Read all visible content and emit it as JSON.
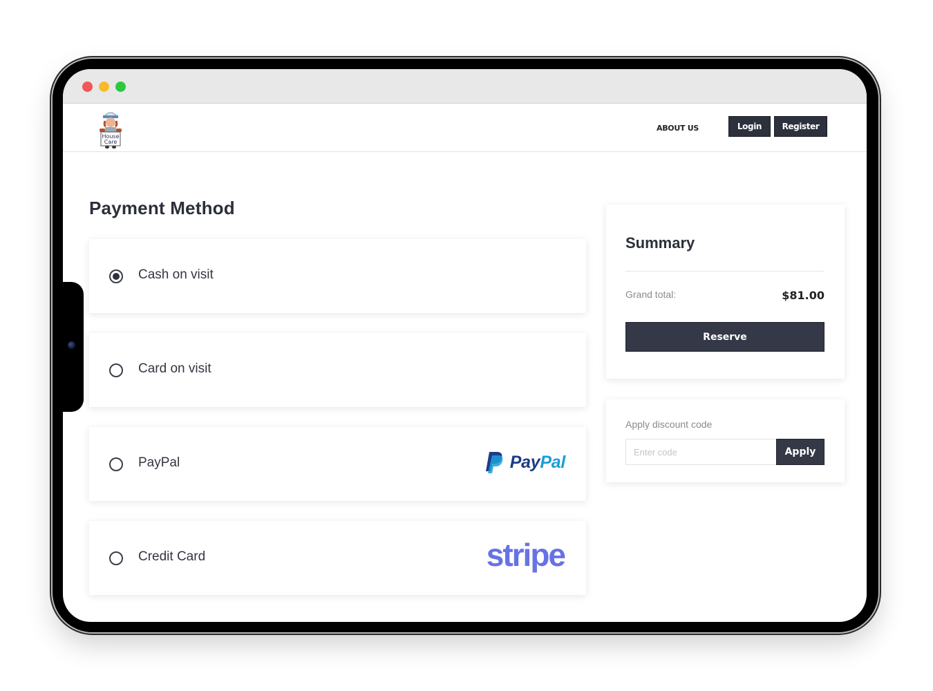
{
  "window": {
    "controls": [
      "close",
      "minimize",
      "maximize"
    ]
  },
  "navbar": {
    "logo_alt": "House Care",
    "about_label": "ABOUT US",
    "login_label": "Login",
    "register_label": "Register"
  },
  "payment": {
    "title": "Payment Method",
    "selected": "cash",
    "options": [
      {
        "id": "cash",
        "label": "Cash on visit",
        "checked": true,
        "logo": null
      },
      {
        "id": "card",
        "label": "Card on visit",
        "checked": false,
        "logo": null
      },
      {
        "id": "paypal",
        "label": "PayPal",
        "checked": false,
        "logo": "paypal-logo"
      },
      {
        "id": "credit",
        "label": "Credit Card",
        "checked": false,
        "logo": "stripe-logo"
      }
    ],
    "paypal_logo": {
      "pay": "Pay",
      "pal": "Pal"
    },
    "stripe_logo": "stripe"
  },
  "summary": {
    "title": "Summary",
    "grand_total_label": "Grand total:",
    "grand_total_value": "$81.00",
    "reserve_label": "Reserve"
  },
  "discount": {
    "label": "Apply discount code",
    "input_value": "",
    "placeholder": "Enter code",
    "apply_label": "Apply"
  },
  "colors": {
    "primary_dark": "#353846",
    "paypal_dark": "#1d3c88",
    "paypal_light": "#1c9ed8",
    "stripe": "#6772e5"
  }
}
